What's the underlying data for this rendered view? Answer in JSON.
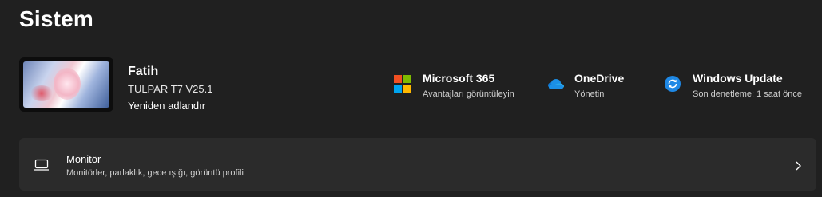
{
  "header": {
    "title": "Sistem"
  },
  "device": {
    "name": "Fatih",
    "model": "TULPAR T7 V25.1",
    "rename_label": "Yeniden adlandır"
  },
  "quick_links": [
    {
      "title": "Microsoft 365",
      "subtitle": "Avantajları görüntüleyin",
      "icon": "microsoft-logo-icon"
    },
    {
      "title": "OneDrive",
      "subtitle": "Yönetin",
      "icon": "onedrive-cloud-icon"
    },
    {
      "title": "Windows Update",
      "subtitle": "Son denetleme: 1 saat önce",
      "icon": "windows-update-icon"
    }
  ],
  "settings": [
    {
      "title": "Monitör",
      "subtitle": "Monitörler, parlaklık, gece ışığı, görüntü profili",
      "icon": "monitor-icon"
    }
  ],
  "colors": {
    "background": "#202020",
    "card": "#2b2b2b",
    "ms_red": "#f25022",
    "ms_green": "#7fba00",
    "ms_blue": "#00a4ef",
    "ms_yellow": "#ffb900",
    "onedrive_blue": "#0f78d4",
    "update_blue": "#1e88e5"
  }
}
